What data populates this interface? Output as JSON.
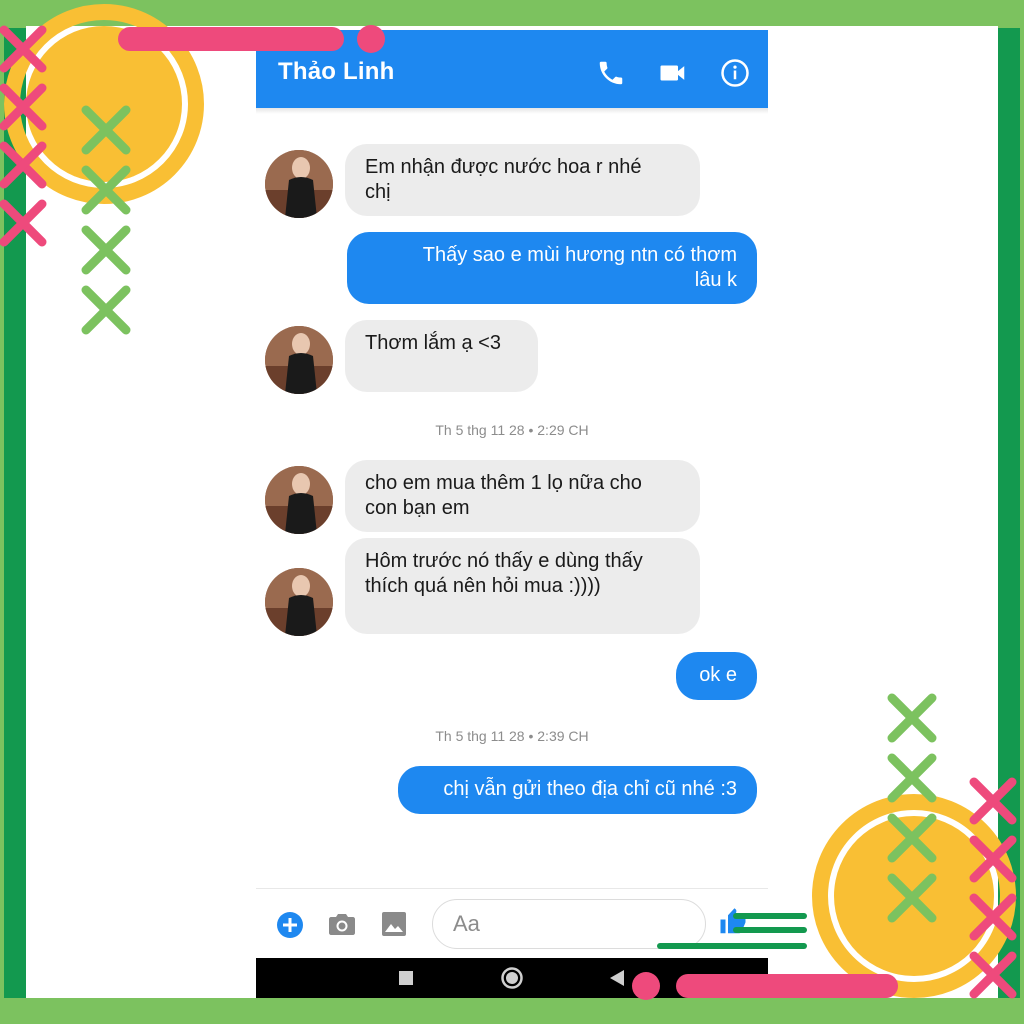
{
  "header": {
    "contact_name": "Thảo Linh",
    "icons": [
      "phone-icon",
      "video-camera-icon",
      "info-icon"
    ],
    "color": "#1e88f0"
  },
  "messages": [
    {
      "side": "in",
      "text_lines": [
        "Em nhận được nước hoa r nhé",
        "chị"
      ]
    },
    {
      "side": "out",
      "text_lines": [
        "Thấy sao e mùi hương ntn có thơm",
        "lâu k"
      ]
    },
    {
      "side": "in",
      "text_lines": [
        "Thơm lắm ạ <3"
      ]
    },
    {
      "side": "in",
      "text_lines": [
        "cho em mua thêm 1 lọ nữa cho",
        "con bạn em"
      ]
    },
    {
      "side": "in",
      "text_lines": [
        "Hôm trước nó thấy e dùng thấy",
        "thích quá nên hỏi mua :))))"
      ]
    },
    {
      "side": "out",
      "text_lines": [
        "ok e"
      ]
    },
    {
      "side": "out",
      "text_lines": [
        "chị vẫn gửi theo địa chỉ cũ nhé :3"
      ]
    }
  ],
  "timestamps": [
    "Th 5 thg 11 28 • 2:29 CH",
    "Th 5 thg 11 28 • 2:39 CH"
  ],
  "composer": {
    "placeholder": "Aa",
    "icons": [
      "add-icon",
      "camera-icon",
      "image-icon",
      "thumbs-up-icon"
    ]
  },
  "navbar": {
    "icons": [
      "square-icon",
      "circle-icon",
      "back-triangle-icon"
    ]
  },
  "colors": {
    "outer_frame_light": "#7cc25f",
    "outer_frame_dark": "#13994f",
    "bubble_out": "#1e88f0",
    "bubble_in": "#ececec",
    "deco_pink": "#ee4a7c",
    "deco_yellow": "#f9bf34"
  }
}
